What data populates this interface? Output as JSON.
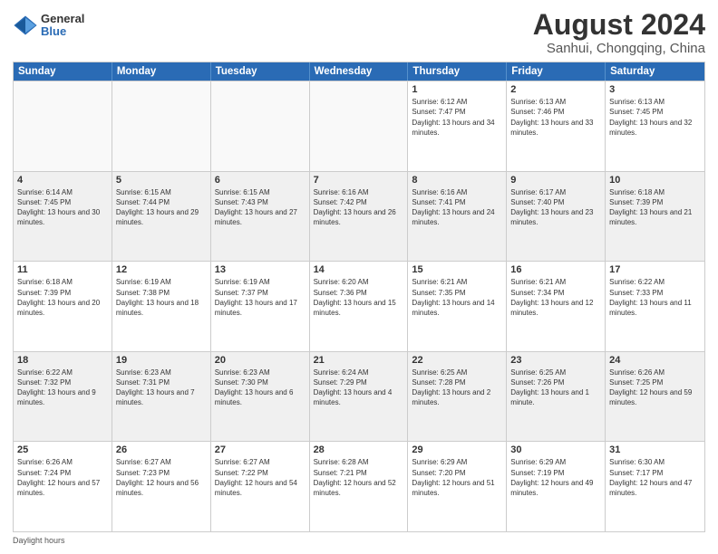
{
  "logo": {
    "general": "General",
    "blue": "Blue"
  },
  "title": "August 2024",
  "subtitle": "Sanhui, Chongqing, China",
  "days_of_week": [
    "Sunday",
    "Monday",
    "Tuesday",
    "Wednesday",
    "Thursday",
    "Friday",
    "Saturday"
  ],
  "weeks": [
    [
      {
        "day": "",
        "info": ""
      },
      {
        "day": "",
        "info": ""
      },
      {
        "day": "",
        "info": ""
      },
      {
        "day": "",
        "info": ""
      },
      {
        "day": "1",
        "info": "Sunrise: 6:12 AM\nSunset: 7:47 PM\nDaylight: 13 hours and 34 minutes."
      },
      {
        "day": "2",
        "info": "Sunrise: 6:13 AM\nSunset: 7:46 PM\nDaylight: 13 hours and 33 minutes."
      },
      {
        "day": "3",
        "info": "Sunrise: 6:13 AM\nSunset: 7:45 PM\nDaylight: 13 hours and 32 minutes."
      }
    ],
    [
      {
        "day": "4",
        "info": "Sunrise: 6:14 AM\nSunset: 7:45 PM\nDaylight: 13 hours and 30 minutes."
      },
      {
        "day": "5",
        "info": "Sunrise: 6:15 AM\nSunset: 7:44 PM\nDaylight: 13 hours and 29 minutes."
      },
      {
        "day": "6",
        "info": "Sunrise: 6:15 AM\nSunset: 7:43 PM\nDaylight: 13 hours and 27 minutes."
      },
      {
        "day": "7",
        "info": "Sunrise: 6:16 AM\nSunset: 7:42 PM\nDaylight: 13 hours and 26 minutes."
      },
      {
        "day": "8",
        "info": "Sunrise: 6:16 AM\nSunset: 7:41 PM\nDaylight: 13 hours and 24 minutes."
      },
      {
        "day": "9",
        "info": "Sunrise: 6:17 AM\nSunset: 7:40 PM\nDaylight: 13 hours and 23 minutes."
      },
      {
        "day": "10",
        "info": "Sunrise: 6:18 AM\nSunset: 7:39 PM\nDaylight: 13 hours and 21 minutes."
      }
    ],
    [
      {
        "day": "11",
        "info": "Sunrise: 6:18 AM\nSunset: 7:39 PM\nDaylight: 13 hours and 20 minutes."
      },
      {
        "day": "12",
        "info": "Sunrise: 6:19 AM\nSunset: 7:38 PM\nDaylight: 13 hours and 18 minutes."
      },
      {
        "day": "13",
        "info": "Sunrise: 6:19 AM\nSunset: 7:37 PM\nDaylight: 13 hours and 17 minutes."
      },
      {
        "day": "14",
        "info": "Sunrise: 6:20 AM\nSunset: 7:36 PM\nDaylight: 13 hours and 15 minutes."
      },
      {
        "day": "15",
        "info": "Sunrise: 6:21 AM\nSunset: 7:35 PM\nDaylight: 13 hours and 14 minutes."
      },
      {
        "day": "16",
        "info": "Sunrise: 6:21 AM\nSunset: 7:34 PM\nDaylight: 13 hours and 12 minutes."
      },
      {
        "day": "17",
        "info": "Sunrise: 6:22 AM\nSunset: 7:33 PM\nDaylight: 13 hours and 11 minutes."
      }
    ],
    [
      {
        "day": "18",
        "info": "Sunrise: 6:22 AM\nSunset: 7:32 PM\nDaylight: 13 hours and 9 minutes."
      },
      {
        "day": "19",
        "info": "Sunrise: 6:23 AM\nSunset: 7:31 PM\nDaylight: 13 hours and 7 minutes."
      },
      {
        "day": "20",
        "info": "Sunrise: 6:23 AM\nSunset: 7:30 PM\nDaylight: 13 hours and 6 minutes."
      },
      {
        "day": "21",
        "info": "Sunrise: 6:24 AM\nSunset: 7:29 PM\nDaylight: 13 hours and 4 minutes."
      },
      {
        "day": "22",
        "info": "Sunrise: 6:25 AM\nSunset: 7:28 PM\nDaylight: 13 hours and 2 minutes."
      },
      {
        "day": "23",
        "info": "Sunrise: 6:25 AM\nSunset: 7:26 PM\nDaylight: 13 hours and 1 minute."
      },
      {
        "day": "24",
        "info": "Sunrise: 6:26 AM\nSunset: 7:25 PM\nDaylight: 12 hours and 59 minutes."
      }
    ],
    [
      {
        "day": "25",
        "info": "Sunrise: 6:26 AM\nSunset: 7:24 PM\nDaylight: 12 hours and 57 minutes."
      },
      {
        "day": "26",
        "info": "Sunrise: 6:27 AM\nSunset: 7:23 PM\nDaylight: 12 hours and 56 minutes."
      },
      {
        "day": "27",
        "info": "Sunrise: 6:27 AM\nSunset: 7:22 PM\nDaylight: 12 hours and 54 minutes."
      },
      {
        "day": "28",
        "info": "Sunrise: 6:28 AM\nSunset: 7:21 PM\nDaylight: 12 hours and 52 minutes."
      },
      {
        "day": "29",
        "info": "Sunrise: 6:29 AM\nSunset: 7:20 PM\nDaylight: 12 hours and 51 minutes."
      },
      {
        "day": "30",
        "info": "Sunrise: 6:29 AM\nSunset: 7:19 PM\nDaylight: 12 hours and 49 minutes."
      },
      {
        "day": "31",
        "info": "Sunrise: 6:30 AM\nSunset: 7:17 PM\nDaylight: 12 hours and 47 minutes."
      }
    ]
  ],
  "footer": "Daylight hours"
}
